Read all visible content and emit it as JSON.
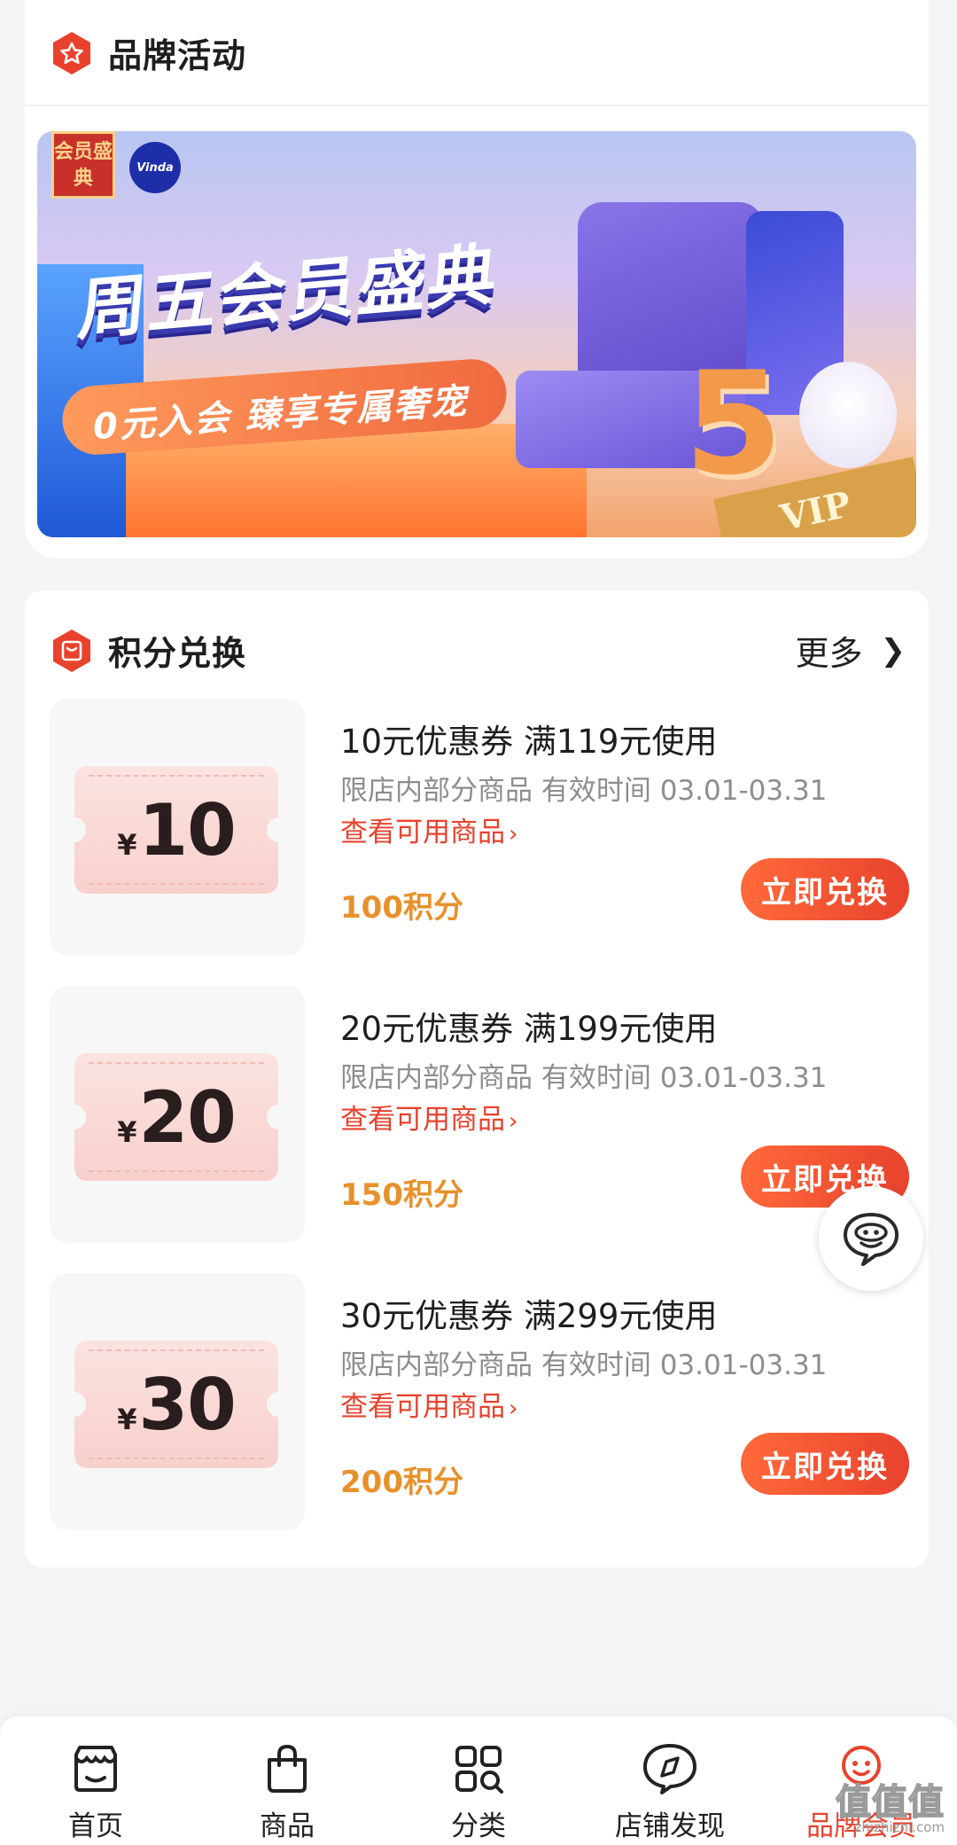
{
  "brand_section": {
    "title": "品牌活动",
    "banner": {
      "badge_text": "会员盛典",
      "brand_logo": "Vinda",
      "title": "周五会员盛典",
      "subtitle": "0元入会 臻享专属奢宠",
      "number": "5",
      "vip_label": "VIP"
    }
  },
  "points_section": {
    "title": "积分兑换",
    "more_label": "更多",
    "items": [
      {
        "currency": "¥",
        "amount": "10",
        "title": "10元优惠券 满119元使用",
        "desc": "限店内部分商品 有效时间 03.01-03.31",
        "link": "查看可用商品",
        "points": "100积分",
        "button": "立即兑换"
      },
      {
        "currency": "¥",
        "amount": "20",
        "title": "20元优惠券 满199元使用",
        "desc": "限店内部分商品 有效时间 03.01-03.31",
        "link": "查看可用商品",
        "points": "150积分",
        "button": "立即兑换"
      },
      {
        "currency": "¥",
        "amount": "30",
        "title": "30元优惠券 满299元使用",
        "desc": "限店内部分商品 有效时间 03.01-03.31",
        "link": "查看可用商品",
        "points": "200积分",
        "button": "立即兑换"
      }
    ]
  },
  "tabbar": {
    "items": [
      {
        "label": "首页",
        "icon": "store-icon"
      },
      {
        "label": "商品",
        "icon": "shopping-bag-icon"
      },
      {
        "label": "分类",
        "icon": "grid-icon"
      },
      {
        "label": "店铺发现",
        "icon": "compass-icon"
      },
      {
        "label": "品牌会员",
        "icon": "member-icon",
        "active": true
      }
    ]
  },
  "watermark": {
    "text": "值值值",
    "url": "zhizhizhi.com"
  },
  "colors": {
    "accent": "#e8422d",
    "points": "#e8912c",
    "ticket": "#f7d0cc"
  }
}
